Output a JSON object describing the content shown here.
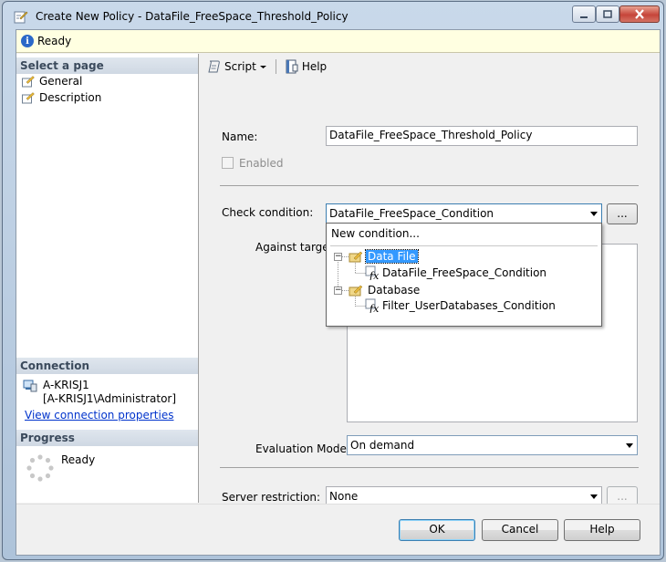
{
  "window": {
    "title": "Create New Policy - DataFile_FreeSpace_Threshold_Policy"
  },
  "status": {
    "text": "Ready"
  },
  "left": {
    "select_page_header": "Select a page",
    "pages": [
      {
        "label": "General"
      },
      {
        "label": "Description"
      }
    ],
    "connection_header": "Connection",
    "server": "A-KRISJ1",
    "user": "[A-KRISJ1\\Administrator]",
    "view_connection_link": "View connection properties",
    "progress_header": "Progress",
    "progress_status": "Ready"
  },
  "toolbar": {
    "script_label": "Script",
    "help_label": "Help"
  },
  "form": {
    "name_label": "Name:",
    "name_value": "DataFile_FreeSpace_Threshold_Policy",
    "enabled_label": "Enabled",
    "check_condition_label": "Check condition:",
    "check_condition_value": "DataFile_FreeSpace_Condition",
    "ellipsis": "...",
    "against_targets_label": "Against targets",
    "evaluation_mode_label": "Evaluation Mode:",
    "evaluation_mode_value": "On demand",
    "server_restriction_label": "Server restriction:",
    "server_restriction_value": "None"
  },
  "dropdown": {
    "new_condition": "New condition...",
    "groups": [
      {
        "label": "Data File",
        "items": [
          "DataFile_FreeSpace_Condition"
        ]
      },
      {
        "label": "Database",
        "items": [
          "Filter_UserDatabases_Condition"
        ]
      }
    ]
  },
  "buttons": {
    "ok": "OK",
    "cancel": "Cancel",
    "help": "Help"
  },
  "colors": {
    "selection": "#3399ff",
    "status_bg": "#ffffe1",
    "link": "#0033cc"
  }
}
